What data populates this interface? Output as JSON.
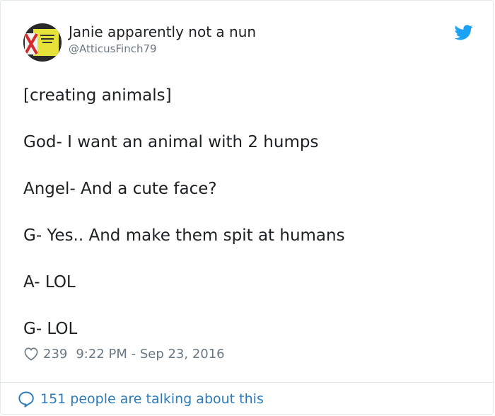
{
  "user": {
    "display_name": "Janie apparently not a nun",
    "handle": "@AtticusFinch79",
    "avatar_icon": "avatar-image",
    "platform_icon": "twitter-bird-icon"
  },
  "tweet": {
    "lines": [
      "[creating animals]",
      "",
      "God- I want an animal with 2 humps",
      "",
      "Angel- And a cute face?",
      "",
      "G- Yes.. And make them spit at humans",
      "",
      "A- LOL",
      "",
      "G- LOL"
    ]
  },
  "meta": {
    "like_count": "239",
    "timestamp": "9:22 PM - Sep 23, 2016"
  },
  "footer": {
    "talking_text": "151 people are talking about this"
  },
  "colors": {
    "link_blue": "#2b7bb9",
    "twitter_blue": "#1da1f2",
    "muted_gray": "#697882",
    "text_dark": "#1c2022",
    "border": "#e1e8ed"
  }
}
